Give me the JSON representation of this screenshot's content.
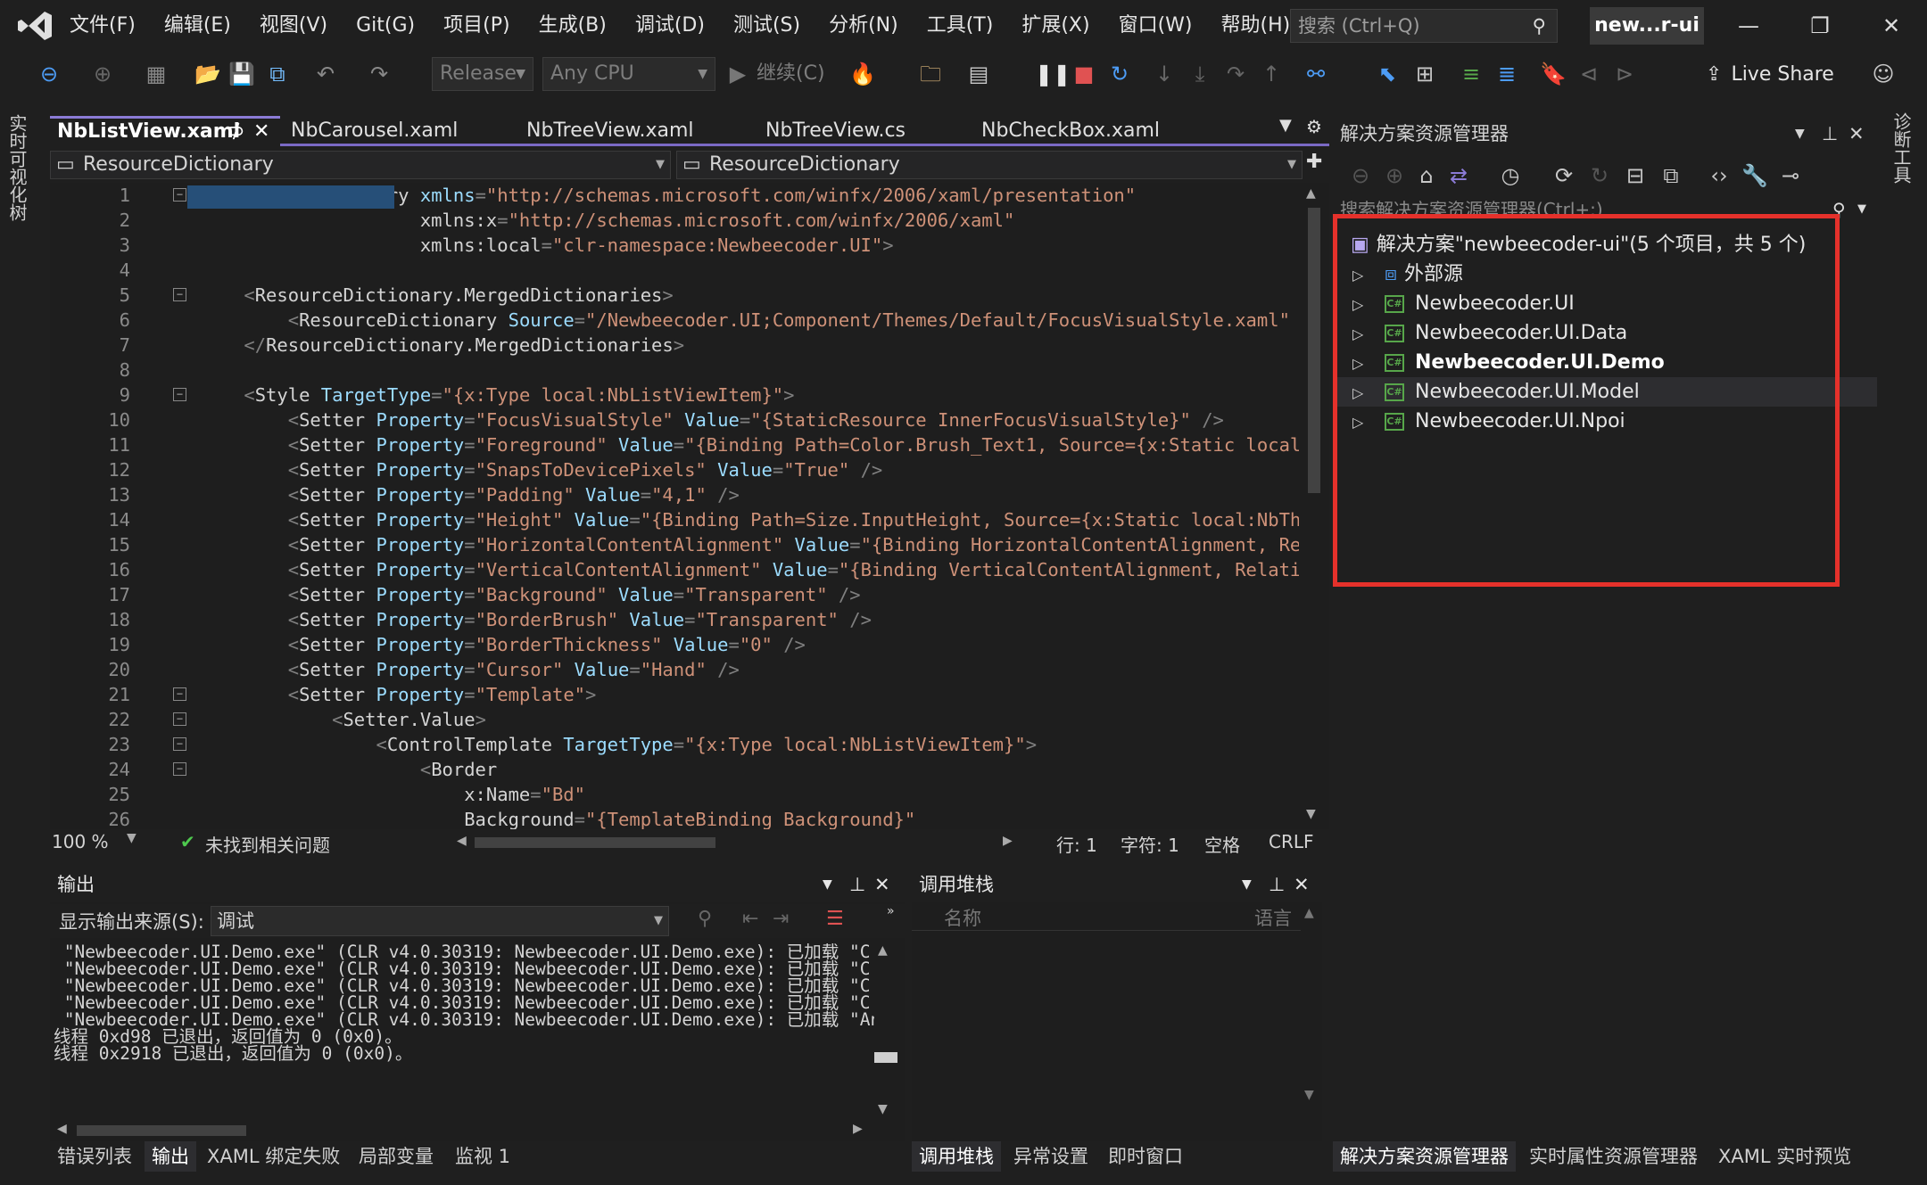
{
  "menu": [
    "文件(F)",
    "编辑(E)",
    "视图(V)",
    "Git(G)",
    "项目(P)",
    "生成(B)",
    "调试(D)",
    "测试(S)",
    "分析(N)",
    "工具(T)",
    "扩展(X)",
    "窗口(W)",
    "帮助(H)"
  ],
  "search": {
    "placeholder": "搜索 (Ctrl+Q)"
  },
  "solution_badge": "new...r-ui",
  "window_controls": {
    "minimize": "—",
    "restore": "❐",
    "close": "✕"
  },
  "toolbar": {
    "config": "Release",
    "platform": "Any CPU",
    "continue": "继续(C)",
    "live_share": "Live Share"
  },
  "left_strip": "实时可视化树",
  "right_strip": "诊断工具",
  "editor_tabs": [
    "NbListView.xaml",
    "NbCarousel.xaml",
    "NbTreeView.xaml",
    "NbTreeView.cs",
    "NbCheckBox.xaml"
  ],
  "tab_pin": "⊅",
  "tab_close": "✕",
  "nav": {
    "left": "ResourceDictionary",
    "right": "ResourceDictionary"
  },
  "code_lines": [
    {
      "n": "1",
      "t": "<ResourceDictionary xmlns=\"http://schemas.microsoft.com/winfx/2006/xaml/presentation\""
    },
    {
      "n": "2",
      "t": "                    xmlns:x=\"http://schemas.microsoft.com/winfx/2006/xaml\""
    },
    {
      "n": "3",
      "t": "                    xmlns:local=\"clr-namespace:Newbeecoder.UI\">"
    },
    {
      "n": "4",
      "t": ""
    },
    {
      "n": "5",
      "t": "    <ResourceDictionary.MergedDictionaries>"
    },
    {
      "n": "6",
      "t": "        <ResourceDictionary Source=\"/Newbeecoder.UI;Component/Themes/Default/FocusVisualStyle.xaml\" />"
    },
    {
      "n": "7",
      "t": "    </ResourceDictionary.MergedDictionaries>"
    },
    {
      "n": "8",
      "t": ""
    },
    {
      "n": "9",
      "t": "    <Style TargetType=\"{x:Type local:NbListViewItem}\">"
    },
    {
      "n": "10",
      "t": "        <Setter Property=\"FocusVisualStyle\" Value=\"{StaticResource InnerFocusVisualStyle}\" />"
    },
    {
      "n": "11",
      "t": "        <Setter Property=\"Foreground\" Value=\"{Binding Path=Color.Brush_Text1, Source={x:Static local:Nb"
    },
    {
      "n": "12",
      "t": "        <Setter Property=\"SnapsToDevicePixels\" Value=\"True\" />"
    },
    {
      "n": "13",
      "t": "        <Setter Property=\"Padding\" Value=\"4,1\" />"
    },
    {
      "n": "14",
      "t": "        <Setter Property=\"Height\" Value=\"{Binding Path=Size.InputHeight, Source={x:Static local:NbTheme"
    },
    {
      "n": "15",
      "t": "        <Setter Property=\"HorizontalContentAlignment\" Value=\"{Binding HorizontalContentAlignment, Relat"
    },
    {
      "n": "16",
      "t": "        <Setter Property=\"VerticalContentAlignment\" Value=\"{Binding VerticalContentAlignment, RelativeS"
    },
    {
      "n": "17",
      "t": "        <Setter Property=\"Background\" Value=\"Transparent\" />"
    },
    {
      "n": "18",
      "t": "        <Setter Property=\"BorderBrush\" Value=\"Transparent\" />"
    },
    {
      "n": "19",
      "t": "        <Setter Property=\"BorderThickness\" Value=\"0\" />"
    },
    {
      "n": "20",
      "t": "        <Setter Property=\"Cursor\" Value=\"Hand\" />"
    },
    {
      "n": "21",
      "t": "        <Setter Property=\"Template\">"
    },
    {
      "n": "22",
      "t": "            <Setter.Value>"
    },
    {
      "n": "23",
      "t": "                <ControlTemplate TargetType=\"{x:Type local:NbListViewItem}\">"
    },
    {
      "n": "24",
      "t": "                    <Border"
    },
    {
      "n": "25",
      "t": "                        x:Name=\"Bd\""
    },
    {
      "n": "26",
      "t": "                        Background=\"{TemplateBinding Background}\""
    }
  ],
  "editor_status": {
    "zoom": "100 %",
    "issues": "未找到相关问题",
    "line": "行: 1",
    "char": "字符: 1",
    "spaces": "空格",
    "eol": "CRLF"
  },
  "output": {
    "title": "输出",
    "source_label": "显示输出来源(S):",
    "source_value": "调试",
    "lines": [
      " \"Newbeecoder.UI.Demo.exe\" (CLR v4.0.30319: Newbeecoder.UI.Demo.exe): 已加载 \"C:\\W",
      " \"Newbeecoder.UI.Demo.exe\" (CLR v4.0.30319: Newbeecoder.UI.Demo.exe): 已加载 \"C:\\W",
      " \"Newbeecoder.UI.Demo.exe\" (CLR v4.0.30319: Newbeecoder.UI.Demo.exe): 已加载 \"C:\\W",
      " \"Newbeecoder.UI.Demo.exe\" (CLR v4.0.30319: Newbeecoder.UI.Demo.exe): 已加载 \"C:\\W",
      " \"Newbeecoder.UI.Demo.exe\" (CLR v4.0.30319: Newbeecoder.UI.Demo.exe): 已加载 \"Anon",
      "线程 0xd98 已退出，返回值为 0 (0x0)。",
      "线程 0x2918 已退出，返回值为 0 (0x0)。"
    ],
    "tabs": [
      "错误列表",
      "输出",
      "XAML 绑定失败",
      "局部变量",
      "监视 1"
    ]
  },
  "callstack": {
    "title": "调用堆栈",
    "col_name": "名称",
    "col_lang": "语言",
    "tabs": [
      "调用堆栈",
      "异常设置",
      "即时窗口"
    ]
  },
  "solution_explorer": {
    "title": "解决方案资源管理器",
    "search_placeholder": "搜索解决方案资源管理器(Ctrl+;)",
    "root": "解决方案\"newbeecoder-ui\"(5 个项目，共 5 个)",
    "items": [
      "外部源",
      "Newbeecoder.UI",
      "Newbeecoder.UI.Data",
      "Newbeecoder.UI.Demo",
      "Newbeecoder.UI.Model",
      "Newbeecoder.UI.Npoi"
    ],
    "tabs": [
      "解决方案资源管理器",
      "实时属性资源管理器",
      "XAML 实时预览"
    ]
  },
  "colors": {
    "highlight_box": "#e5312b",
    "tab_accent": "#8b7bd6"
  }
}
